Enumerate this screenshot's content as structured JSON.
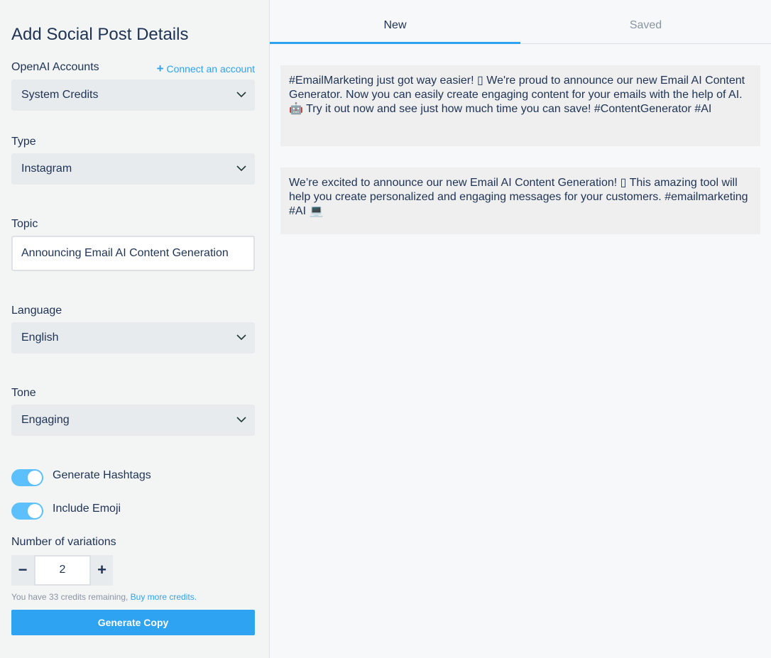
{
  "sidebar": {
    "title": "Add Social Post Details",
    "accounts": {
      "label": "OpenAI Accounts",
      "connect_label": "Connect an account",
      "value": "System Credits"
    },
    "type": {
      "label": "Type",
      "value": "Instagram"
    },
    "topic": {
      "label": "Topic",
      "value": "Announcing Email AI Content Generation"
    },
    "language": {
      "label": "Language",
      "value": "English"
    },
    "tone": {
      "label": "Tone",
      "value": "Engaging"
    },
    "hashtags": {
      "label": "Generate Hashtags",
      "on": true
    },
    "emoji": {
      "label": "Include Emoji",
      "on": true
    },
    "variations": {
      "label": "Number of variations",
      "value": "2",
      "minus": "−",
      "plus": "+"
    },
    "credits": {
      "text": "You have 33 credits remaining,",
      "link": "Buy more credits."
    },
    "generate_label": "Generate Copy"
  },
  "tabs": [
    {
      "label": "New",
      "active": true
    },
    {
      "label": "Saved",
      "active": false
    }
  ],
  "results": [
    {
      "text": "#EmailMarketing just got way easier! ▯ We're proud to announce our new Email AI Content Generator. Now you can easily create engaging content for your emails with the help of AI. 🤖 Try it out now and see just how much time you can save! #ContentGenerator #AI"
    },
    {
      "text": "We’re excited to announce our new Email AI Content Generation! ▯ This amazing tool will help you create personalized and engaging messages for your customers. #emailmarketing #AI 💻"
    }
  ],
  "colors": {
    "accent": "#2ea3f2",
    "toggle": "#5bc0fb",
    "text": "#1e3354"
  }
}
